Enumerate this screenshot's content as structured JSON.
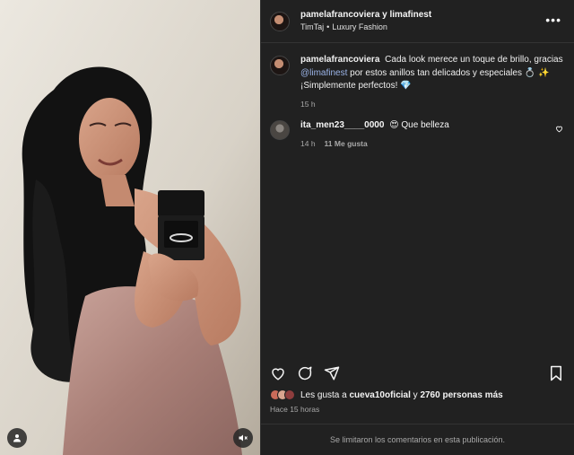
{
  "header": {
    "users": "pamelafrancoviera y limafinest",
    "audio": "TimTaj",
    "category": "Luxury Fashion",
    "more_label": "•••"
  },
  "caption": {
    "user": "pamelafrancoviera",
    "text_before": "Cada look merece un toque de brillo, gracias",
    "mention": "@limafinest",
    "text_after": "por estos anillos tan delicados y especiales 💍 ✨ ¡Simplemente perfectos! 💎",
    "time": "15 h"
  },
  "comments": [
    {
      "user": "ita_men23____0000",
      "text": "😍 Que belleza",
      "time": "14 h",
      "likes": "11 Me gusta"
    }
  ],
  "likes": {
    "prefix": "Les gusta a",
    "user": "cueva10oficial",
    "middle": "y",
    "others": "2760 personas más"
  },
  "posted_ago": "Hace 15 horas",
  "comments_limited": "Se limitaron los comentarios en esta publicación.",
  "icons": [
    "person-tag-icon",
    "mute-icon",
    "heart-icon",
    "comment-icon",
    "share-icon",
    "save-icon",
    "more-icon"
  ],
  "colors": {
    "panel_bg": "#212121",
    "mention": "#9bb4e8",
    "muted_text": "#a8a8a8"
  }
}
